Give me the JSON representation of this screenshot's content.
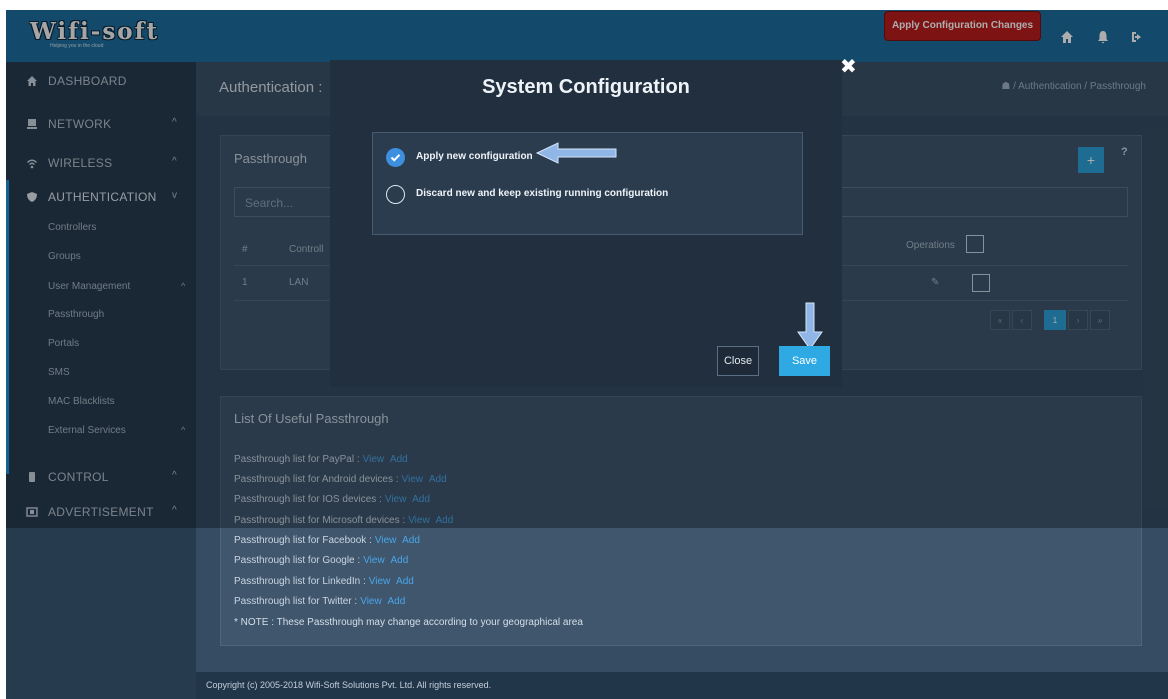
{
  "header": {
    "logo_text": "Wifi-soft",
    "logo_tagline": "Helping you in the cloud",
    "apply_button": "Apply Configuration Changes",
    "icons": [
      "home-icon",
      "bell-icon",
      "logout-icon"
    ]
  },
  "sidebar": {
    "items": [
      {
        "label": "DASHBOARD",
        "icon": "home-icon"
      },
      {
        "label": "NETWORK",
        "icon": "monitor-icon"
      },
      {
        "label": "WIRELESS",
        "icon": "wifi-icon"
      },
      {
        "label": "AUTHENTICATION",
        "icon": "shield-icon"
      },
      {
        "label": "CONTROL",
        "icon": "control-icon"
      },
      {
        "label": "ADVERTISEMENT",
        "icon": "advertisement-icon"
      }
    ],
    "sub_items": [
      "Controllers",
      "Groups",
      "User Management",
      "Passthrough",
      "Portals",
      "SMS",
      "MAC Blacklists",
      "External Services"
    ]
  },
  "page": {
    "title": "Authentication :",
    "breadcrumb": "/ Authentication / Passthrough"
  },
  "passthrough_panel": {
    "title": "Passthrough",
    "search_placeholder": "Search...",
    "columns": [
      "#",
      "Controll"
    ],
    "operations_label": "Operations",
    "rows": [
      {
        "num": "1",
        "controller": "LAN"
      }
    ],
    "pagination": [
      "«",
      "‹",
      "1",
      "›",
      "»"
    ],
    "add_label": "+",
    "help_label": "?"
  },
  "useful_panel": {
    "title": "List Of Useful Passthrough",
    "items": [
      "Passthrough list for PayPal :",
      "Passthrough list for Android devices :",
      "Passthrough list for IOS devices :",
      "Passthrough list for Microsoft devices :",
      "Passthrough list for Facebook :",
      "Passthrough list for Google :",
      "Passthrough list for LinkedIn :",
      "Passthrough list for Twitter :"
    ],
    "view_label": "View",
    "add_label": "Add",
    "note": "* NOTE : These Passthrough may change according to your geographical area"
  },
  "footer": {
    "copyright": "Copyright (c) 2005-2018 Wifi-Soft Solutions Pvt. Ltd. All rights reserved."
  },
  "modal": {
    "title": "System Configuration",
    "close_icon": "close-icon",
    "options": [
      {
        "label": "Apply new configuration",
        "selected": true
      },
      {
        "label": "Discard new and keep existing running configuration",
        "selected": false
      }
    ],
    "close_button": "Close",
    "save_button": "Save"
  },
  "colors": {
    "header": "#1d6d9e",
    "sidebar": "#273b4f",
    "content": "#364c63",
    "accent": "#2fa9e4",
    "apply_button": "#b91c1c",
    "modal": "#222f3e"
  }
}
